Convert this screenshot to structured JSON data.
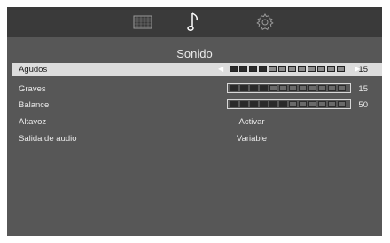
{
  "tabs": [
    {
      "icon": "picture-icon"
    },
    {
      "icon": "music-note-icon",
      "active": true
    },
    {
      "icon": "gear-icon"
    }
  ],
  "title": "Sonido",
  "rows": [
    {
      "label": "Agudos",
      "type": "bar",
      "value": "15",
      "level_segments": 4,
      "total_segments": 12,
      "selected": true
    },
    {
      "label": "Graves",
      "type": "bar",
      "value": "15",
      "level_segments": 4,
      "total_segments": 12
    },
    {
      "label": "Balance",
      "type": "bar",
      "value": "50",
      "level_segments": 6,
      "total_segments": 12
    },
    {
      "label": "Altavoz",
      "type": "text",
      "value": "Activar"
    },
    {
      "label": "Salida de audio",
      "type": "text",
      "value": "Variable"
    }
  ],
  "colors": {
    "osd_bg": "#575757",
    "topbar_bg": "#3a3a3a",
    "selected_row": "#dcdcdc"
  }
}
